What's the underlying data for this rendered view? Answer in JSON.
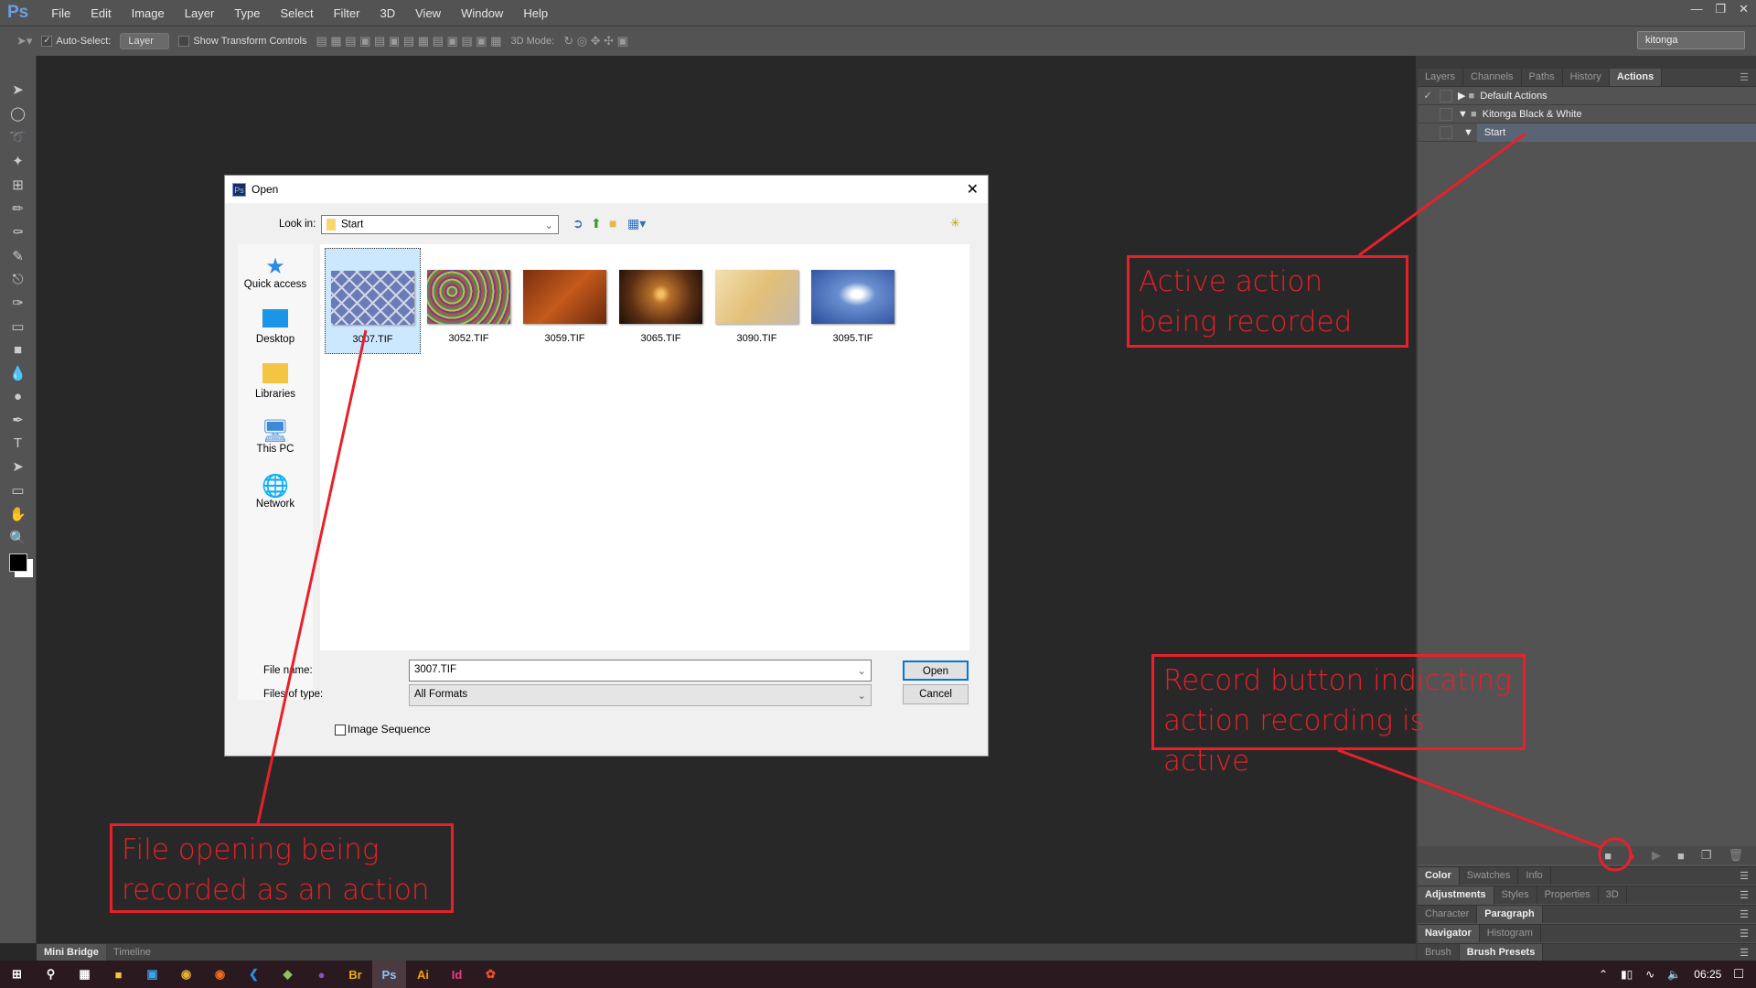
{
  "app": {
    "logo": "Ps",
    "menu": [
      "File",
      "Edit",
      "Image",
      "Layer",
      "Type",
      "Select",
      "Filter",
      "3D",
      "View",
      "Window",
      "Help"
    ]
  },
  "options": {
    "auto_select": "Auto-Select:",
    "layer_select": "Layer",
    "show_transform": "Show Transform Controls",
    "mode_3d": "3D Mode:",
    "workspace": "kitonga"
  },
  "panel": {
    "tabs": [
      "Layers",
      "Channels",
      "Paths",
      "History",
      "Actions"
    ],
    "active_tab": "Actions",
    "actions": [
      {
        "name": "Default Actions"
      },
      {
        "name": "Kitonga Black & White"
      },
      {
        "name": "Start"
      }
    ],
    "groups": [
      [
        "Color",
        "Swatches",
        "Info"
      ],
      [
        "Adjustments",
        "Styles",
        "Properties",
        "3D"
      ],
      [
        "Character",
        "Paragraph"
      ],
      [
        "Navigator",
        "Histogram"
      ],
      [
        "Brush",
        "Brush Presets"
      ]
    ]
  },
  "bottom_tabs": [
    "Mini Bridge",
    "Timeline"
  ],
  "dialog": {
    "title": "Open",
    "look_in_label": "Look in:",
    "look_in": "Start",
    "places": [
      "Quick access",
      "Desktop",
      "Libraries",
      "This PC",
      "Network"
    ],
    "files": [
      "3007.TIF",
      "3052.TIF",
      "3059.TIF",
      "3065.TIF",
      "3090.TIF",
      "3095.TIF"
    ],
    "file_name_label": "File name:",
    "file_name": "3007.TIF",
    "type_label": "Files of type:",
    "file_type": "All Formats",
    "open": "Open",
    "cancel": "Cancel",
    "image_sequence": "Image Sequence"
  },
  "taskbar": {
    "apps": [
      "Br",
      "Ps",
      "Ai",
      "Id"
    ],
    "time": "06:25"
  },
  "annotations": {
    "active_action": "Active action being recorded",
    "record_button": "Record button indicating action recording is active",
    "file_opening": "File opening being recorded as an action"
  },
  "colors": {
    "annotation": "#e8202a",
    "record": "#e8202a"
  }
}
